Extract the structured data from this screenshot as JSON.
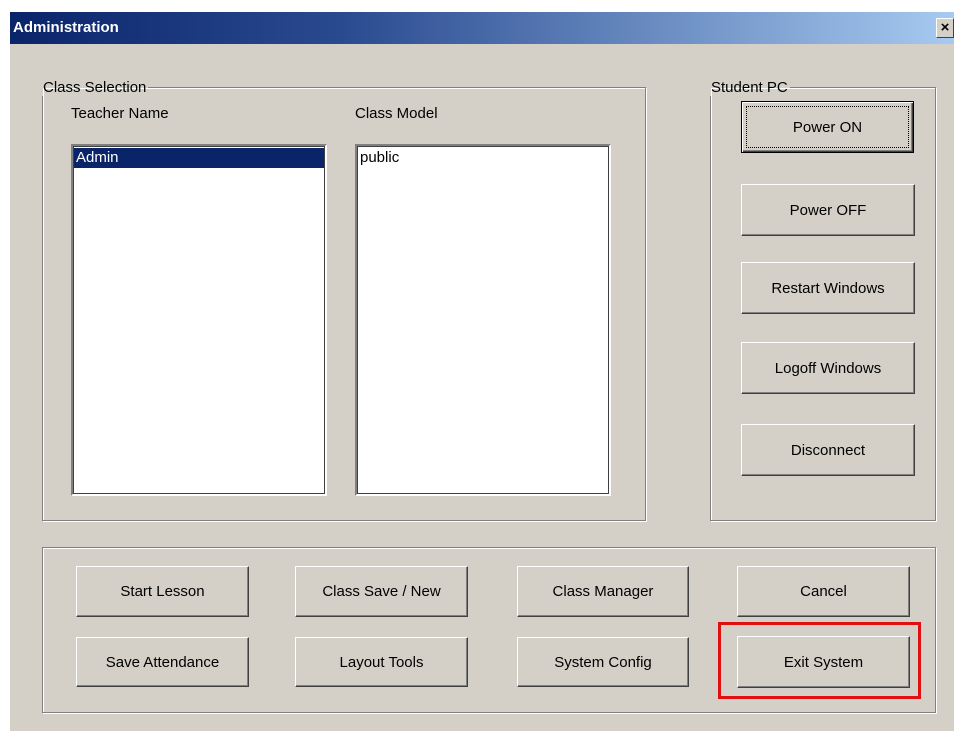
{
  "window": {
    "title": "Administration",
    "close_symbol": "×"
  },
  "class_selection": {
    "legend": "Class Selection",
    "teacher_name_label": "Teacher Name",
    "class_model_label": "Class Model",
    "teachers": [
      {
        "name": "Admin",
        "selected": true
      }
    ],
    "class_models": [
      {
        "name": "public",
        "selected": false
      }
    ]
  },
  "student_pc": {
    "legend": "Student PC",
    "buttons": {
      "power_on": "Power ON",
      "power_off": "Power OFF",
      "restart": "Restart Windows",
      "logoff": "Logoff Windows",
      "disconnect": "Disconnect"
    }
  },
  "actions": {
    "start_lesson": "Start Lesson",
    "class_save_new": "Class Save / New",
    "class_manager": "Class Manager",
    "cancel": "Cancel",
    "save_attendance": "Save Attendance",
    "layout_tools": "Layout Tools",
    "system_config": "System Config",
    "exit_system": "Exit System"
  },
  "colors": {
    "title_gradient_start": "#0a246a",
    "title_gradient_end": "#a6caf0",
    "dialog_face": "#d4d0c8",
    "selection": "#0a246a",
    "highlight_box": "#e01010"
  }
}
